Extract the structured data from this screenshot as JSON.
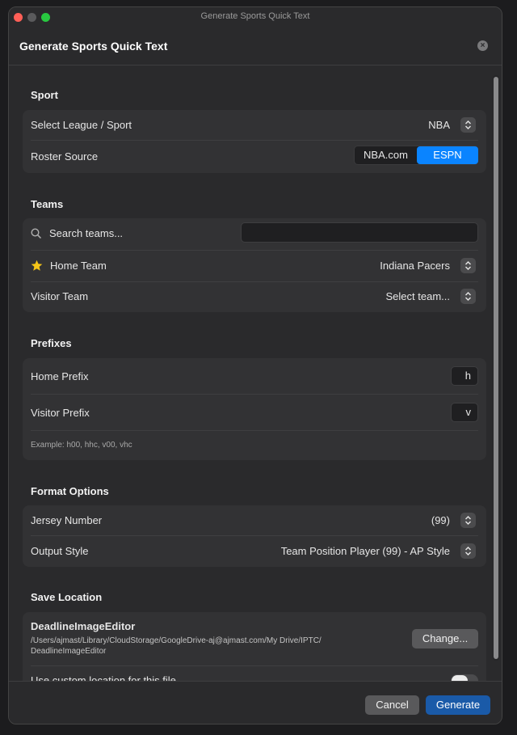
{
  "window": {
    "title": "Generate Sports Quick Text"
  },
  "sheet": {
    "title": "Generate Sports Quick Text"
  },
  "sport": {
    "title": "Sport",
    "league_label": "Select League / Sport",
    "league_value": "NBA",
    "roster_label": "Roster Source",
    "roster_options": [
      "NBA.com",
      "ESPN"
    ],
    "roster_selected": "ESPN"
  },
  "teams": {
    "title": "Teams",
    "search_placeholder": "Search teams...",
    "search_value": "",
    "home_label": "Home Team",
    "home_value": "Indiana Pacers",
    "visitor_label": "Visitor Team",
    "visitor_value": "Select team..."
  },
  "prefixes": {
    "title": "Prefixes",
    "home_label": "Home Prefix",
    "home_value": "h",
    "visitor_label": "Visitor Prefix",
    "visitor_value": "v",
    "example": "Example: h00, hhc, v00, vhc"
  },
  "format": {
    "title": "Format Options",
    "jersey_label": "Jersey Number",
    "jersey_value": "(99)",
    "style_label": "Output Style",
    "style_value": "Team Position Player (99) - AP Style"
  },
  "save": {
    "title": "Save Location",
    "folder_name": "DeadlineImageEditor",
    "path_line1": "/Users/ajmast/Library/CloudStorage/GoogleDrive-aj@ajmast.com/My Drive/IPTC/",
    "path_line2": "DeadlineImageEditor",
    "change_label": "Change...",
    "custom_label": "Use custom location for this file",
    "custom_enabled": false
  },
  "footer": {
    "cancel_label": "Cancel",
    "generate_label": "Generate"
  },
  "colors": {
    "accent": "#0a84ff",
    "primary_button": "#1a5aa8",
    "star": "#f5c518"
  }
}
